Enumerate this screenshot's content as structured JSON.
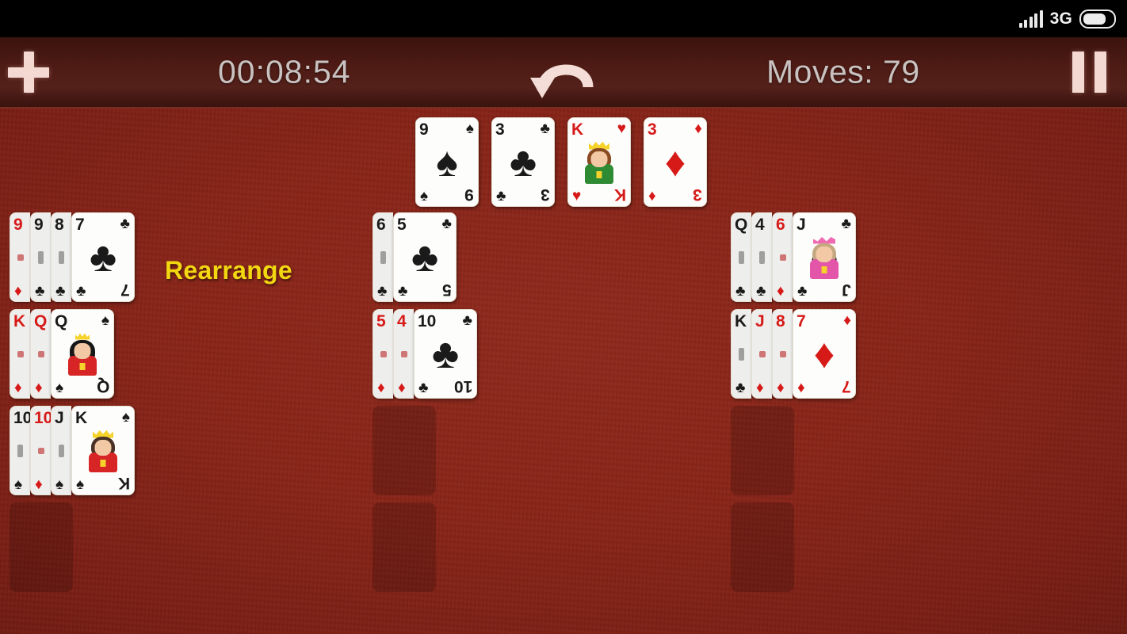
{
  "statusbar": {
    "network_label": "3G",
    "signal_icon": "signal-bars-icon",
    "battery_icon": "battery-icon"
  },
  "toolbar": {
    "new_game_icon": "plus-icon",
    "timer": "00:08:54",
    "undo_icon": "undo-arrow-icon",
    "moves": "Moves: 79",
    "pause_icon": "pause-icon"
  },
  "board": {
    "rearrange_label": "Rearrange",
    "accent_color": "#f2d711",
    "felt_color": "#8a2418",
    "slot_color": "#6b1a12",
    "free_cells": [
      {
        "rank": "9",
        "suit": "♠",
        "color": "blk",
        "figure": null
      },
      {
        "rank": "3",
        "suit": "♣",
        "color": "blk",
        "figure": null
      },
      {
        "rank": "K",
        "suit": "♥",
        "color": "red",
        "figure": "king-h"
      },
      {
        "rank": "3",
        "suit": "♦",
        "color": "red",
        "figure": null
      }
    ],
    "columns": [
      {
        "name": "left-column",
        "piles": [
          {
            "cards": [
              {
                "rank": "9",
                "suit": "♦",
                "color": "red",
                "covered": true
              },
              {
                "rank": "9",
                "suit": "♣",
                "color": "blk",
                "covered": true
              },
              {
                "rank": "8",
                "suit": "♣",
                "color": "blk",
                "covered": true
              },
              {
                "rank": "7",
                "suit": "♣",
                "color": "blk",
                "covered": false,
                "figure": null
              }
            ]
          },
          {
            "cards": [
              {
                "rank": "K",
                "suit": "♦",
                "color": "red",
                "covered": true
              },
              {
                "rank": "Q",
                "suit": "♦",
                "color": "red",
                "covered": true
              },
              {
                "rank": "Q",
                "suit": "♠",
                "color": "blk",
                "covered": false,
                "figure": "queen-s"
              }
            ]
          },
          {
            "cards": [
              {
                "rank": "10",
                "suit": "♠",
                "color": "blk",
                "covered": true
              },
              {
                "rank": "10",
                "suit": "♦",
                "color": "red",
                "covered": true
              },
              {
                "rank": "J",
                "suit": "♠",
                "color": "blk",
                "covered": true
              },
              {
                "rank": "K",
                "suit": "♠",
                "color": "blk",
                "covered": false,
                "figure": "king-s"
              }
            ]
          },
          {
            "empty": true
          }
        ]
      },
      {
        "name": "middle-column",
        "piles": [
          {
            "cards": [
              {
                "rank": "6",
                "suit": "♣",
                "color": "blk",
                "covered": true
              },
              {
                "rank": "5",
                "suit": "♣",
                "color": "blk",
                "covered": false,
                "figure": null
              }
            ]
          },
          {
            "cards": [
              {
                "rank": "5",
                "suit": "♦",
                "color": "red",
                "covered": true
              },
              {
                "rank": "4",
                "suit": "♦",
                "color": "red",
                "covered": true
              },
              {
                "rank": "10",
                "suit": "♣",
                "color": "blk",
                "covered": false,
                "figure": null
              }
            ]
          },
          {
            "empty": true
          },
          {
            "empty": true
          }
        ]
      },
      {
        "name": "right-column",
        "piles": [
          {
            "cards": [
              {
                "rank": "Q",
                "suit": "♣",
                "color": "blk",
                "covered": true
              },
              {
                "rank": "4",
                "suit": "♣",
                "color": "blk",
                "covered": true
              },
              {
                "rank": "6",
                "suit": "♦",
                "color": "red",
                "covered": true
              },
              {
                "rank": "J",
                "suit": "♣",
                "color": "blk",
                "covered": false,
                "figure": "jack-c"
              }
            ]
          },
          {
            "cards": [
              {
                "rank": "K",
                "suit": "♣",
                "color": "blk",
                "covered": true
              },
              {
                "rank": "J",
                "suit": "♦",
                "color": "red",
                "covered": true
              },
              {
                "rank": "8",
                "suit": "♦",
                "color": "red",
                "covered": true
              },
              {
                "rank": "7",
                "suit": "♦",
                "color": "red",
                "covered": false,
                "figure": null
              }
            ]
          },
          {
            "empty": true
          },
          {
            "empty": true
          }
        ]
      }
    ]
  }
}
